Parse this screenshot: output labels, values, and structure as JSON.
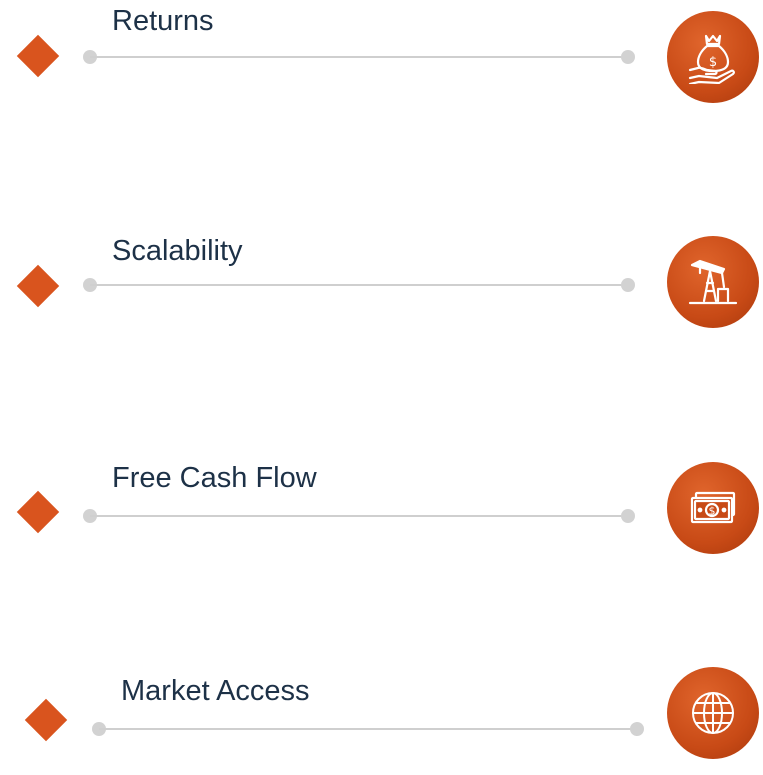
{
  "accent_color": "#d9541e",
  "line_color": "#cfcfcf",
  "text_color": "#1d3147",
  "items": [
    {
      "label": "Returns",
      "icon": "money-bag-hand-icon"
    },
    {
      "label": "Scalability",
      "icon": "oil-pump-icon"
    },
    {
      "label": "Free Cash Flow",
      "icon": "cash-bill-icon"
    },
    {
      "label": "Market Access",
      "icon": "globe-icon"
    }
  ]
}
